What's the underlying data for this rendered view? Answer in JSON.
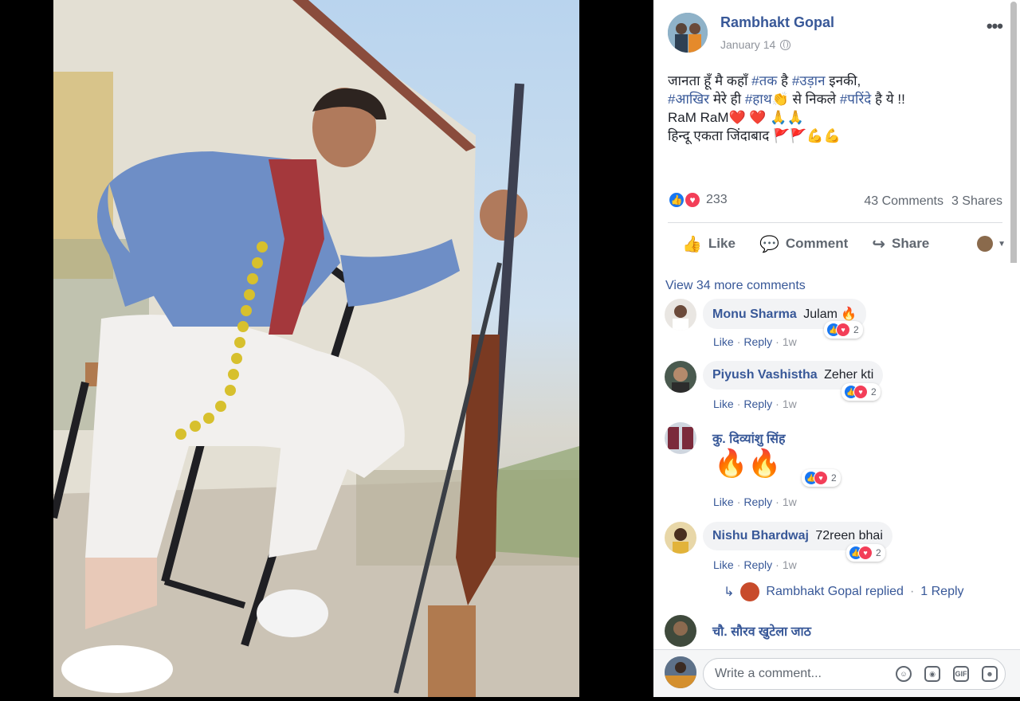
{
  "post": {
    "author": "Rambhakt Gopal",
    "date": "January 14",
    "text_lines": [
      {
        "parts": [
          {
            "t": "जानता हूँ मै कहाँ ",
            "tag": false
          },
          {
            "t": "#तक",
            "tag": true
          },
          {
            "t": " है ",
            "tag": false
          },
          {
            "t": "#उड़ान",
            "tag": true
          },
          {
            "t": " इनकी,",
            "tag": false
          }
        ]
      },
      {
        "parts": [
          {
            "t": "#आखिर",
            "tag": true
          },
          {
            "t": " मेरे ही ",
            "tag": false
          },
          {
            "t": "#हाथ",
            "tag": true
          },
          {
            "t": "👏 से निकले ",
            "tag": false
          },
          {
            "t": "#परिंदे",
            "tag": true
          },
          {
            "t": " है ये !!",
            "tag": false
          }
        ]
      },
      {
        "parts": [
          {
            "t": "RaM RaM❤️ ❤️ 🙏🙏",
            "tag": false
          }
        ]
      },
      {
        "parts": [
          {
            "t": "हिन्दू एकता जिंदाबाद 🚩🚩💪💪",
            "tag": false
          }
        ]
      }
    ],
    "reaction_count": "233",
    "comments_count": "43 Comments",
    "shares_count": "3 Shares",
    "actions": {
      "like": "Like",
      "comment": "Comment",
      "share": "Share"
    }
  },
  "comments": {
    "view_more": "View 34 more comments",
    "like_label": "Like",
    "reply_label": "Reply",
    "items": [
      {
        "name": "Monu Sharma",
        "text": "Julam 🔥",
        "reacts": "2",
        "time": "1w"
      },
      {
        "name": "Piyush Vashistha",
        "text": "Zeher kti",
        "reacts": "2",
        "time": "1w"
      },
      {
        "name": "कु. दिव्यांशु सिंह",
        "text": "🔥🔥",
        "reacts": "2",
        "time": "1w"
      },
      {
        "name": "Nishu Bhardwaj",
        "text": "72reen bhai",
        "reacts": "2",
        "time": "1w"
      },
      {
        "name": "चौ. सौरव खुटेला जाठ",
        "text": "",
        "reacts": "",
        "time": ""
      }
    ],
    "reply_thread": {
      "who": "Rambhakt Gopal replied",
      "count": "1 Reply"
    }
  },
  "composer": {
    "placeholder": "Write a comment..."
  },
  "colors": {
    "link": "#385898",
    "muted": "#90949c",
    "like": "#1877f2",
    "love": "#f33e58"
  }
}
